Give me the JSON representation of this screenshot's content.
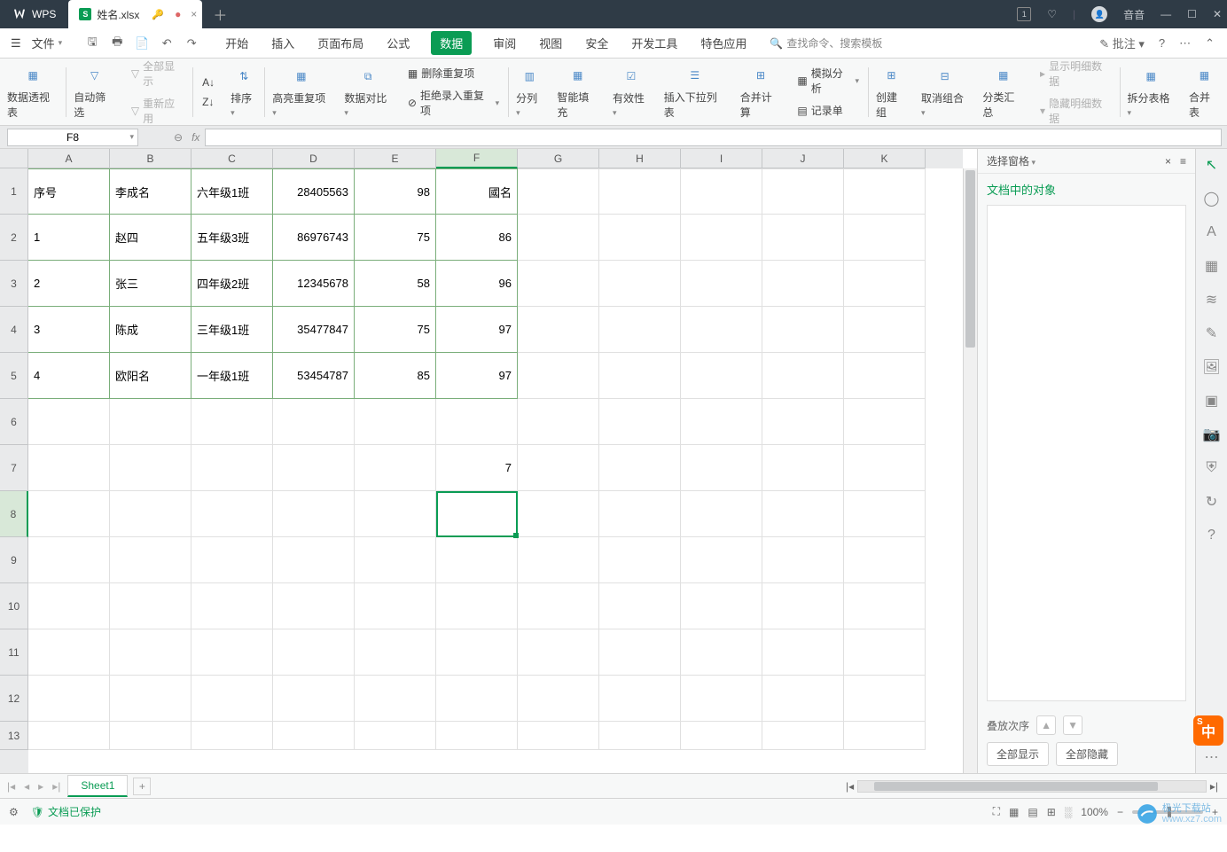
{
  "titlebar": {
    "app": "WPS",
    "tab_name": "姓名.xlsx",
    "badge": "1",
    "user": "音音"
  },
  "menubar": {
    "file": "文件",
    "tabs": [
      "开始",
      "插入",
      "页面布局",
      "公式",
      "数据",
      "审阅",
      "视图",
      "安全",
      "开发工具",
      "特色应用"
    ],
    "active_index": 4,
    "search_placeholder": "查找命令、搜索模板",
    "annotate": "批注"
  },
  "ribbon": {
    "pivot": "数据透视表",
    "autofilter": "自动筛选",
    "show_all": "全部显示",
    "reapply": "重新应用",
    "sort": "排序",
    "highlight_dup": "高亮重复项",
    "data_compare": "数据对比",
    "remove_dup": "删除重复项",
    "reject_dup": "拒绝录入重复项",
    "text_to_cols": "分列",
    "smart_fill": "智能填充",
    "validation": "有效性",
    "insert_dropdown": "插入下拉列表",
    "consolidate": "合并计算",
    "whatif": "模拟分析",
    "record_form": "记录单",
    "group": "创建组",
    "ungroup": "取消组合",
    "subtotal": "分类汇总",
    "show_detail": "显示明细数据",
    "hide_detail": "隐藏明细数据",
    "split_table": "拆分表格",
    "merge_table": "合并表"
  },
  "formula_bar": {
    "cell_ref": "F8",
    "formula": ""
  },
  "columns": [
    "A",
    "B",
    "C",
    "D",
    "E",
    "F",
    "G",
    "H",
    "I",
    "J",
    "K"
  ],
  "rows_shown": 13,
  "cells": {
    "r1": {
      "A": "序号",
      "B": "李成名",
      "C": "六年级1班",
      "D": "28405563",
      "E": "98",
      "F": "國名"
    },
    "r2": {
      "A": "1",
      "B": "赵四",
      "C": "五年级3班",
      "D": "86976743",
      "E": "75",
      "F": "86"
    },
    "r3": {
      "A": "2",
      "B": "张三",
      "C": "四年级2班",
      "D": "12345678",
      "E": "58",
      "F": "96"
    },
    "r4": {
      "A": "3",
      "B": "陈成",
      "C": "三年级1班",
      "D": "35477847",
      "E": "75",
      "F": "97"
    },
    "r5": {
      "A": "4",
      "B": "欧阳名",
      "C": "一年级1班",
      "D": "53454787",
      "E": "85",
      "F": "97"
    },
    "r7": {
      "F": "7"
    }
  },
  "selected_cell": "F8",
  "side_panel": {
    "header": "选择窗格",
    "title": "文档中的对象",
    "order_label": "叠放次序",
    "show_all": "全部显示",
    "hide_all": "全部隐藏"
  },
  "sheet_tabs": {
    "active": "Sheet1"
  },
  "statusbar": {
    "protect": "文档已保护",
    "zoom": "100%"
  },
  "watermark": {
    "brand": "极光下载站",
    "url": "www.xz7.com"
  },
  "ime": "S 中"
}
